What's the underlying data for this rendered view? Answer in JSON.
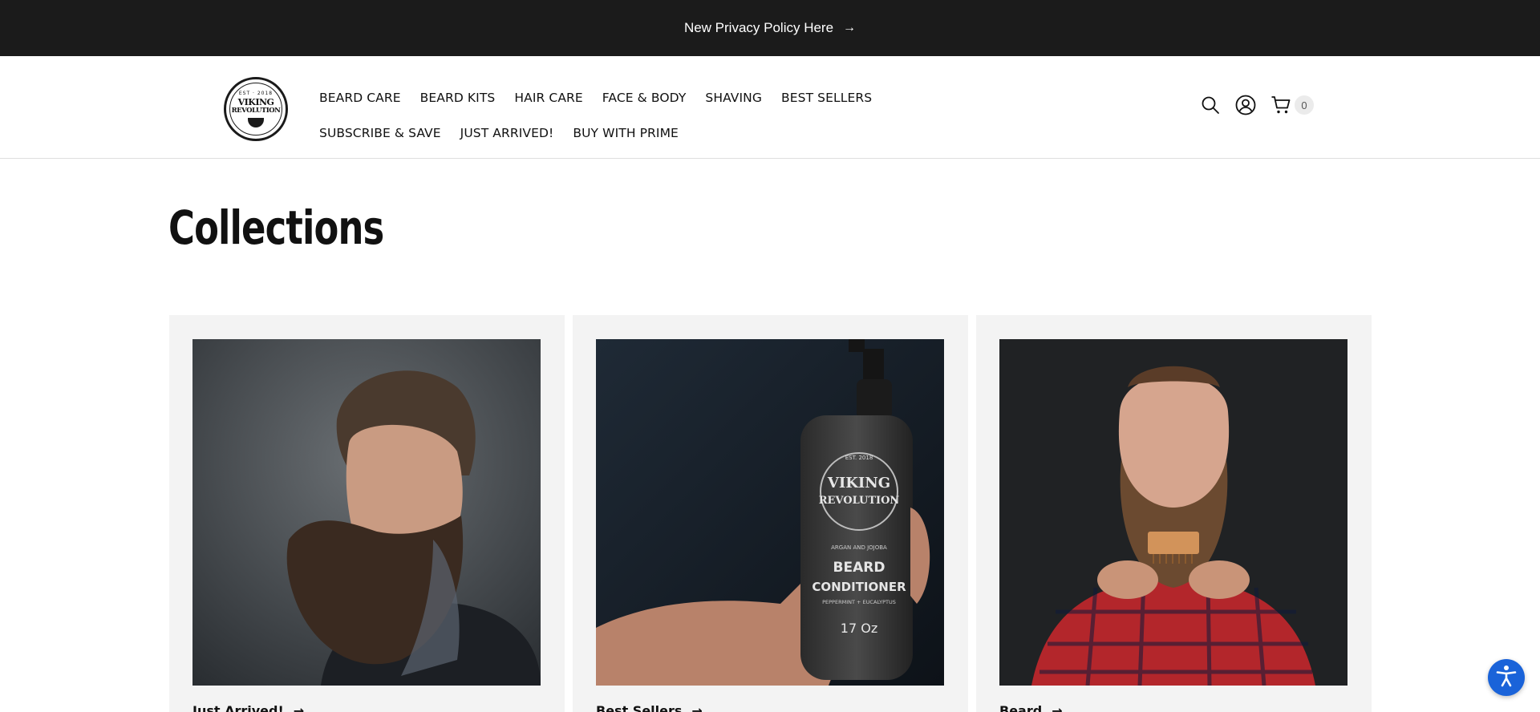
{
  "announcement": {
    "text": "New Privacy Policy Here",
    "arrow": "→"
  },
  "logo": {
    "est": "EST · 2018",
    "line1": "VIKING",
    "line2": "REVOLUTION"
  },
  "nav": {
    "row1": [
      "BEARD CARE",
      "BEARD KITS",
      "HAIR CARE",
      "FACE & BODY",
      "SHAVING",
      "BEST SELLERS"
    ],
    "row2": [
      "SUBSCRIBE & SAVE",
      "JUST ARRIVED!",
      "BUY WITH PRIME"
    ]
  },
  "header_icons": {
    "search": "search-icon",
    "account": "account-icon",
    "cart": "cart-icon"
  },
  "cart": {
    "count": "0"
  },
  "page": {
    "title": "Collections"
  },
  "collections": [
    {
      "label": "Just Arrived!",
      "arrow": "→"
    },
    {
      "label": "Best Sellers",
      "arrow": "→"
    },
    {
      "label": "Beard",
      "arrow": "→"
    }
  ],
  "product_bottle": {
    "est": "EST. 2018",
    "brand1": "VIKING",
    "brand2": "REVOLUTION",
    "subtitle": "ARGAN AND JOJOBA",
    "name1": "BEARD",
    "name2": "CONDITIONER",
    "scent": "PEPPERMINT + EUCALYPTUS",
    "size": "17 Oz"
  },
  "colors": {
    "announcement_bg": "#1b1b1b",
    "card_bg": "#f3f3f3",
    "accessibility_blue": "#1a63d9"
  }
}
